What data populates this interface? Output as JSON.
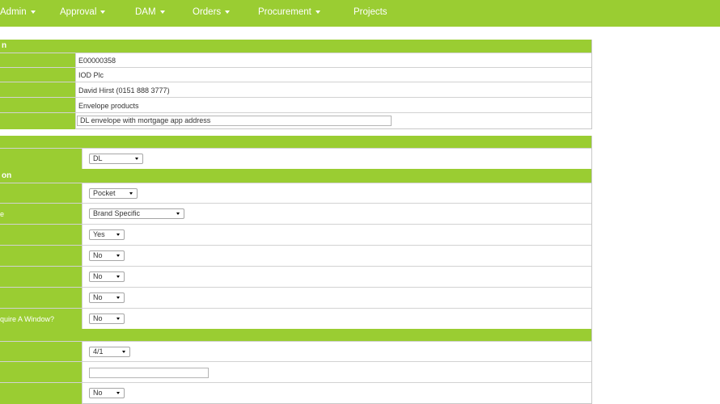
{
  "nav": {
    "items": [
      {
        "label": "Admin",
        "caret": true
      },
      {
        "label": "Approval",
        "caret": true
      },
      {
        "label": "DAM",
        "caret": true
      },
      {
        "label": "Orders",
        "caret": true
      },
      {
        "label": "Procurement",
        "caret": true
      },
      {
        "label": "Projects",
        "caret": false
      }
    ]
  },
  "colors": {
    "accent": "#9acd32",
    "text": "#333333",
    "border": "#c8c8c8"
  },
  "info_panel": {
    "header": "n",
    "rows": [
      {
        "value": "E00000358"
      },
      {
        "value": "IOD Plc"
      },
      {
        "value": "David Hirst (0151 888 3777)"
      },
      {
        "value": "Envelope products"
      },
      {
        "input_value": "DL envelope with mortgage app address"
      }
    ]
  },
  "spec_panel": {
    "size_select": "DL",
    "section_header": "on",
    "rows": [
      {
        "label": "",
        "select": "Pocket"
      },
      {
        "label": "e",
        "select": "Brand Specific"
      },
      {
        "label": "",
        "select": "Yes"
      },
      {
        "label": "",
        "select": "No"
      },
      {
        "label": "",
        "select": "No"
      },
      {
        "label": "",
        "select": "No"
      },
      {
        "label": "quire A Window?",
        "select": "No"
      }
    ],
    "print_rows": [
      {
        "label": "",
        "select": "4/1"
      },
      {
        "label": "",
        "input_value": ""
      },
      {
        "label": "",
        "select": "No"
      }
    ]
  }
}
